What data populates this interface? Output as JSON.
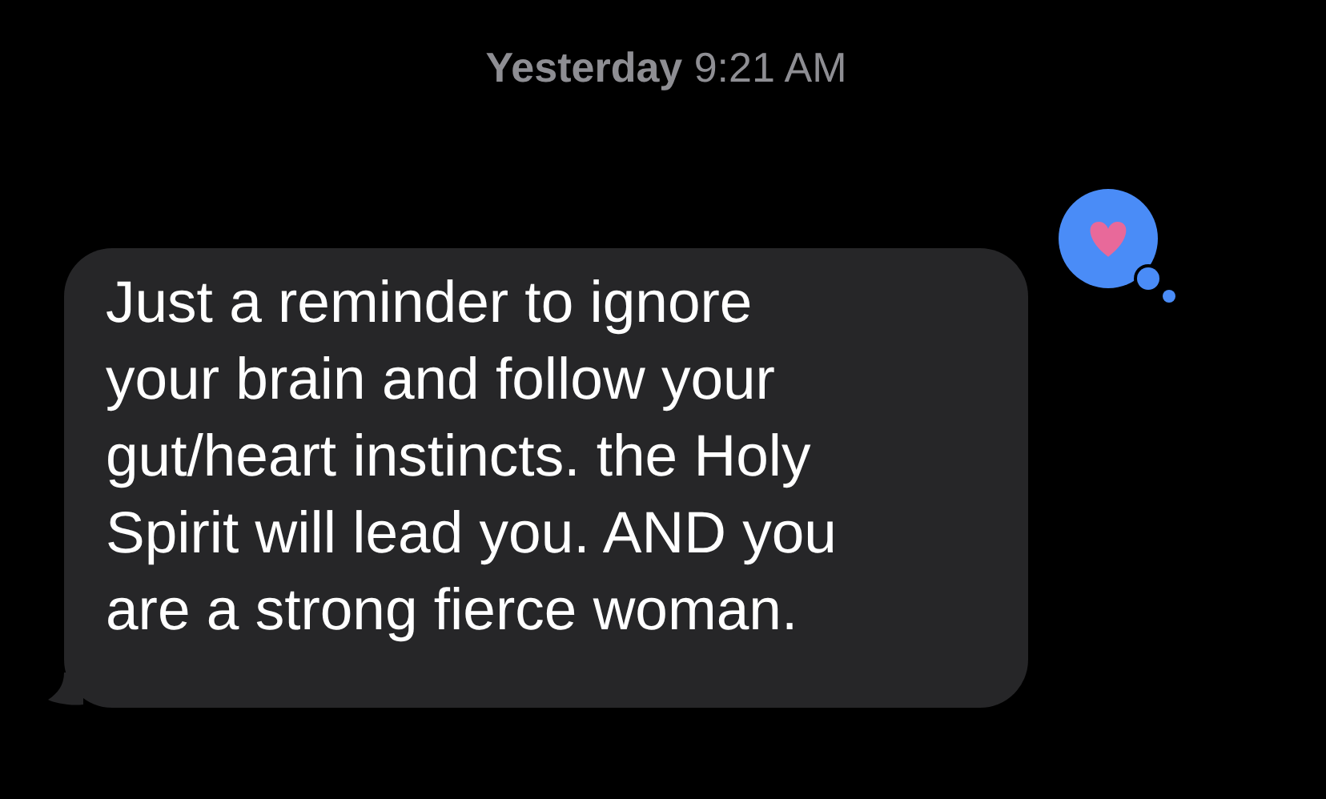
{
  "timestamp": "**Yesterday** 9:21 AM",
  "message": {
    "lines": [
      "Just a reminder to ignore",
      "your brain and follow your",
      "gut/heart instincts. the Holy",
      "Spirit will lead you. AND you",
      "are a strong fierce woman."
    ],
    "reaction": {
      "kind": "heart"
    }
  }
}
